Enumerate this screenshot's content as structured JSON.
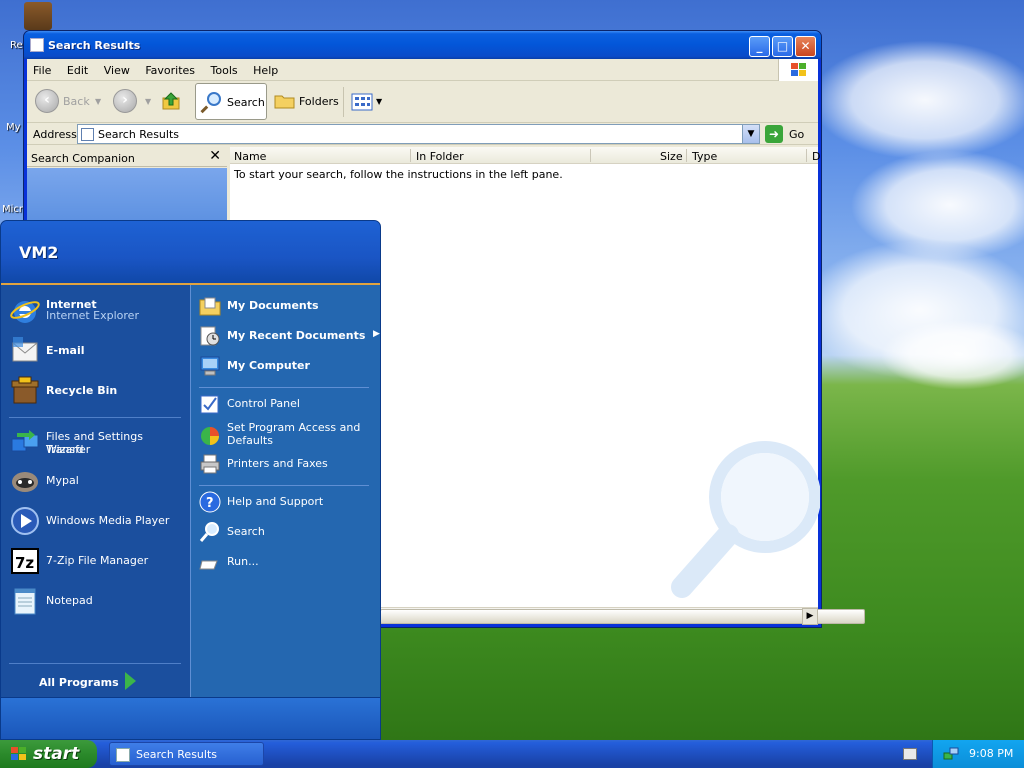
{
  "desktop": {
    "icons": [
      {
        "label": "Re"
      },
      {
        "label": "My"
      },
      {
        "label": "Micr"
      }
    ]
  },
  "explorer": {
    "title": "Search Results",
    "menu": [
      "File",
      "Edit",
      "View",
      "Favorites",
      "Tools",
      "Help"
    ],
    "toolbar": {
      "back": "Back",
      "search": "Search",
      "folders": "Folders"
    },
    "address": {
      "label": "Address",
      "value": "Search Results",
      "go": "Go"
    },
    "companion": {
      "title": "Search Companion",
      "close": "✕"
    },
    "columns": [
      "Name",
      "In Folder",
      "Size",
      "Type",
      "D"
    ],
    "empty_message": "To start your search, follow the instructions in the left pane."
  },
  "start_menu": {
    "user": "VM2",
    "pinned": [
      {
        "label": "Internet",
        "sub": "Internet Explorer",
        "icon": "internet-explorer-icon"
      },
      {
        "label": "E-mail",
        "icon": "email-icon"
      },
      {
        "label": "Recycle Bin",
        "icon": "recycle-bin-icon"
      }
    ],
    "recent": [
      {
        "label": "Files and Settings Transfer",
        "label2": "Wizard",
        "icon": "transfer-wizard-icon"
      },
      {
        "label": "Mypal",
        "icon": "mypal-icon"
      },
      {
        "label": "Windows Media Player",
        "icon": "media-player-icon"
      },
      {
        "label": "7-Zip File Manager",
        "icon": "7zip-icon"
      },
      {
        "label": "Notepad",
        "icon": "notepad-icon"
      }
    ],
    "all_programs": "All Programs",
    "right": [
      {
        "label": "My Documents",
        "bold": true,
        "icon": "my-documents-icon"
      },
      {
        "label": "My Recent Documents",
        "bold": true,
        "icon": "recent-documents-icon"
      },
      {
        "label": "My Computer",
        "bold": true,
        "icon": "my-computer-icon"
      },
      {
        "label": "Control Panel",
        "bold": false,
        "icon": "control-panel-icon"
      },
      {
        "label": "Set Program Access and",
        "label2": "Defaults",
        "bold": false,
        "icon": "program-access-icon"
      },
      {
        "label": "Printers and Faxes",
        "bold": false,
        "icon": "printer-icon"
      },
      {
        "label": "Help and Support",
        "bold": false,
        "icon": "help-icon"
      },
      {
        "label": "Search",
        "bold": false,
        "icon": "search-icon"
      },
      {
        "label": "Run...",
        "bold": false,
        "icon": "run-icon"
      }
    ]
  },
  "taskbar": {
    "start": "start",
    "window_button": "Search Results",
    "clock": "9:08 PM"
  }
}
